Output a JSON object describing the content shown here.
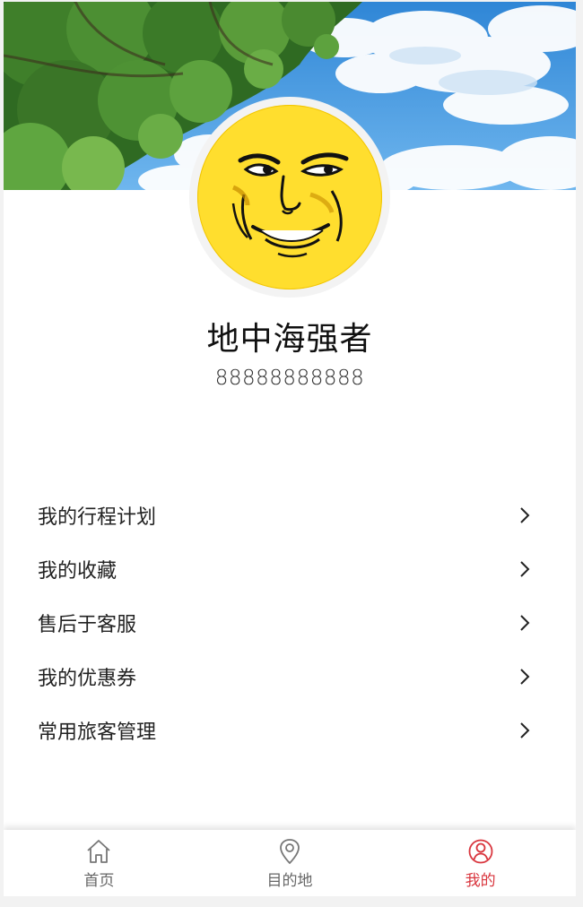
{
  "profile": {
    "name": "地中海强者",
    "phone": "88888888888"
  },
  "menu": {
    "items": [
      {
        "label": "我的行程计划",
        "icon": "chevron-right-icon"
      },
      {
        "label": "我的收藏",
        "icon": "chevron-right-icon"
      },
      {
        "label": "售后于客服",
        "icon": "chevron-right-icon"
      },
      {
        "label": "我的优惠券",
        "icon": "chevron-right-icon"
      },
      {
        "label": "常用旅客管理",
        "icon": "chevron-right-icon"
      }
    ]
  },
  "tabbar": {
    "tabs": [
      {
        "label": "首页",
        "icon": "home-icon",
        "active": false
      },
      {
        "label": "目的地",
        "icon": "location-pin-icon",
        "active": false
      },
      {
        "label": "我的",
        "icon": "user-icon",
        "active": true
      }
    ]
  },
  "colors": {
    "accent": "#d9363e",
    "tab_inactive": "#666666",
    "sky": "#3e8fd9",
    "avatar_yellow": "#ffde2e"
  }
}
